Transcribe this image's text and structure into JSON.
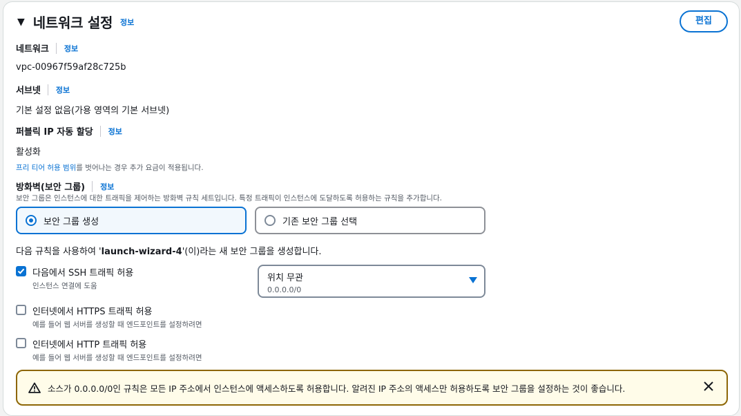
{
  "section": {
    "title": "네트워크 설정",
    "info": "정보",
    "edit_label": "편집"
  },
  "network": {
    "label": "네트워크",
    "info": "정보",
    "value": "vpc-00967f59af28c725b"
  },
  "subnet": {
    "label": "서브넷",
    "info": "정보",
    "value": "기본 설정 없음(가용 영역의 기본 서브넷)"
  },
  "public_ip": {
    "label": "퍼블릭 IP 자동 할당",
    "info": "정보",
    "value": "활성화",
    "note_link": "프리 티어 허용 범위",
    "note_rest": "를 벗어나는 경우 추가 요금이 적용됩니다."
  },
  "firewall": {
    "label": "방화벽(보안 그룹)",
    "info": "정보",
    "description": "보안 그룹은 인스턴스에 대한 트래픽을 제어하는 방화벽 규칙 세트입니다. 특정 트래픽이 인스턴스에 도달하도록 허용하는 규칙을 추가합니다.",
    "option_create": "보안 그룹 생성",
    "option_existing": "기존 보안 그룹 선택",
    "rule_prefix": "다음 규칙을 사용하여 '",
    "rule_name": "launch-wizard-4",
    "rule_suffix": "'(이)라는 새 보안 그룹을 생성합니다."
  },
  "rules": [
    {
      "label": "다음에서 SSH 트래픽 허용",
      "desc": "인스턴스 연결에 도움",
      "checked": true
    },
    {
      "label": "인터넷에서 HTTPS 트래픽 허용",
      "desc": "예를 들어 웹 서버를 생성할 때 엔드포인트를 설정하려면",
      "checked": false
    },
    {
      "label": "인터넷에서 HTTP 트래픽 허용",
      "desc": "예를 들어 웹 서버를 생성할 때 엔드포인트를 설정하려면",
      "checked": false
    }
  ],
  "ssh_source": {
    "value": "위치 무관",
    "detail": "0.0.0.0/0"
  },
  "warning": {
    "text": "소스가 0.0.0.0/0인 규칙은 모든 IP 주소에서 인스턴스에 액세스하도록 허용합니다. 알려진 IP 주소의 액세스만 허용하도록 보안 그룹을 설정하는 것이 좋습니다."
  },
  "colors": {
    "accent": "#0972d3",
    "warning_border": "#8d6605",
    "warning_bg": "#fffce9"
  },
  "icons": {
    "collapse": "caret-down-icon",
    "warning": "warning-icon",
    "close": "close-icon",
    "dropdown": "dropdown-arrow-icon",
    "check": "checkmark-icon"
  }
}
